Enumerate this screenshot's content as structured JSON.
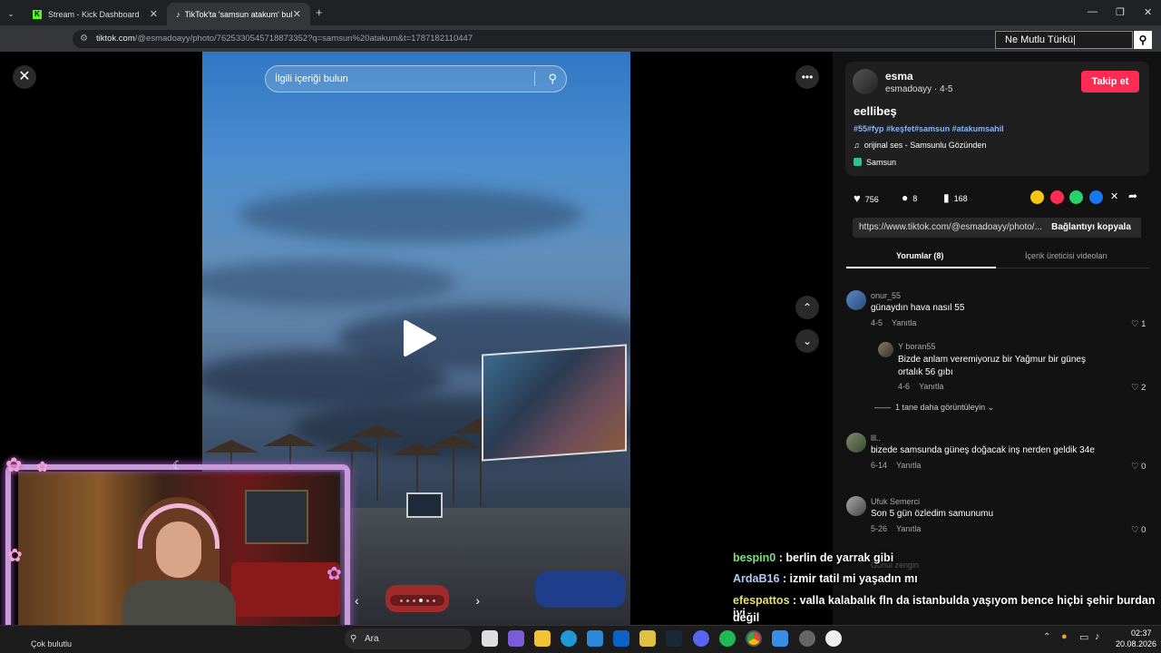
{
  "browser": {
    "tabs": [
      {
        "label": "Stream - Kick Dashboard"
      },
      {
        "label": "TikTok'ta 'samsun atakum' bulu"
      }
    ],
    "url_main": "tiktok.com",
    "url_rest": "/@esmadoayy/photo/7625330545718873352?q=samsun%20atakum&t=1787182110447",
    "overlay_search": "Ne Mutlu Türkü|"
  },
  "photo": {
    "search_placeholder": "İlgili içeriği bulun"
  },
  "post": {
    "username": "esma",
    "handle": "esmadoayy · 4-5",
    "follow_label": "Takip et",
    "caption": "eellibeş",
    "hashtags": "#55#fyp #keşfet#samsun #atakumsahil",
    "sound": "orijinal ses - Samsunlu Gözünden",
    "location": "Samsun",
    "likes": "756",
    "comments": "8",
    "saves": "168",
    "link": "https://www.tiktok.com/@esmadoayy/photo/...",
    "copy_label": "Bağlantıyı kopyala",
    "tab_comments": "Yorumlar (8)",
    "tab_videos": "İçerik üreticisi videoları"
  },
  "comments": [
    {
      "user": "onur_55",
      "text": "günaydın hava nasıl 55",
      "date": "4-5",
      "reply": "Yanıtla",
      "likes": "1"
    },
    {
      "user": "Y boran55",
      "text": "Bizde anlam veremiyoruz bir Yağmur bir güneş ortalık 56 gıbı",
      "date": "4-6",
      "reply": "Yanıtla",
      "likes": "2"
    },
    {
      "user": "lll..",
      "text": "bizede samsunda güneş doğacak inş nerden geldik 34e",
      "date": "6-14",
      "reply": "Yanıtla",
      "likes": "0"
    },
    {
      "user": "Ufuk Semerci",
      "text": "Son 5 gün özledim samunumu",
      "date": "5-26",
      "reply": "Yanıtla",
      "likes": "0"
    }
  ],
  "more_replies": "1 tane daha görüntüleyin",
  "hidden_user": "Gönül zengin",
  "chat": [
    {
      "user": "bespin0",
      "color": "#7de07d",
      "msg": ": berlin de yarrak gibi"
    },
    {
      "user": "ArdaB16",
      "color": "#b0c8ff",
      "msg": ": izmir tatil mi yaşadın mı"
    },
    {
      "user": "efespattos",
      "color": "#e8e070",
      "msg": ": valla kalabalık fln da istanbulda yaşıyom bence hiçbi şehir burdan iyi"
    },
    {
      "user": "",
      "color": "#ffffff",
      "msg": "değil"
    }
  ],
  "taskbar": {
    "search": "Ara",
    "weather": "Çok bulutlu",
    "time": "02:37",
    "date": "20.08.2026"
  }
}
